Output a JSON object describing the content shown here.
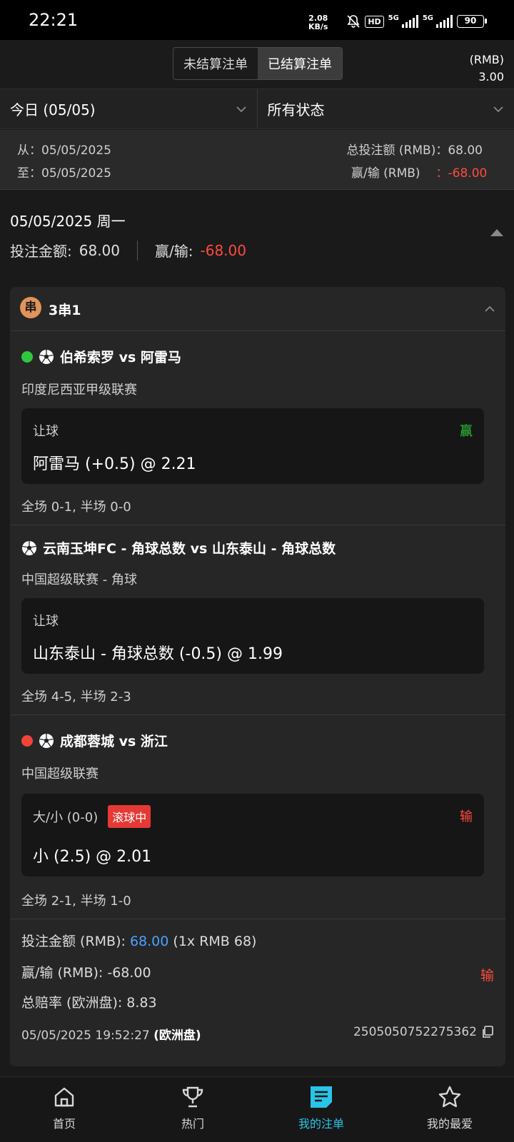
{
  "status_bar": {
    "time": "22:21",
    "speed_value": "2.08",
    "speed_unit": "KB/s",
    "network_1": "5G",
    "network_2": "5G",
    "battery": "90"
  },
  "header": {
    "tabs": [
      {
        "label": "未结算注单",
        "active": false
      },
      {
        "label": "已结算注单",
        "active": true
      }
    ],
    "currency": "(RMB)",
    "balance": "3.00"
  },
  "filters": {
    "date": "今日 (05/05)",
    "status": "所有状态"
  },
  "summary": {
    "from": "从：05/05/2025",
    "to": "至：05/05/2025",
    "total_stake": "总投注额 (RMB)：68.00",
    "winloss_label": "赢/输 (RMB)",
    "winloss_value": "：-68.00"
  },
  "day": {
    "date": "05/05/2025 周一",
    "stake_label": "投注金额:",
    "stake_value": "68.00",
    "winloss_label": "赢/输:",
    "winloss_value": "-68.00"
  },
  "bet": {
    "type_badge": "串",
    "type": "3串1",
    "legs": [
      {
        "status_dot": "green",
        "match": "伯希索罗 vs 阿雷马",
        "league": "印度尼西亚甲级联赛",
        "market": "让球",
        "selection": "阿雷马 (+0.5) @ 2.21",
        "result": "赢",
        "score": "全场 0-1, 半场 0-0"
      },
      {
        "status_dot": "",
        "match": "云南玉坤FC - 角球总数 vs 山东泰山 - 角球总数",
        "league": "中国超级联赛 - 角球",
        "market": "让球",
        "selection": "山东泰山 - 角球总数 (-0.5) @ 1.99",
        "result": "",
        "score": "全场 4-5, 半场 2-3"
      },
      {
        "status_dot": "red",
        "match": "成都蓉城 vs 浙江",
        "league": "中国超级联赛",
        "market": "大/小 (0-0)",
        "live_tag": "滚球中",
        "selection": "小 (2.5) @ 2.01",
        "result": "输",
        "score": "全场 2-1, 半场 1-0"
      }
    ],
    "stake_label": "投注金额 (RMB):",
    "stake_value": "68.00",
    "stake_detail": "(1x RMB 68)",
    "winloss": "赢/输 (RMB): -68.00",
    "winloss_result": "输",
    "odds": "总赔率 (欧洲盘): 8.83",
    "datetime": "05/05/2025 19:52:27",
    "odds_type": "(欧洲盘)",
    "bet_id": "2505050752275362"
  },
  "nav": [
    {
      "label": "首页",
      "icon": "home-icon"
    },
    {
      "label": "热门",
      "icon": "trophy-icon"
    },
    {
      "label": "我的注单",
      "icon": "bet-slip-icon",
      "active": true
    },
    {
      "label": "我的最爱",
      "icon": "star-icon"
    }
  ],
  "colors": {
    "win": "#2fc83d",
    "lose": "#ff4b3e",
    "accent": "#29c4e8",
    "stake_blue": "#49a2ff",
    "badge": "#e0935a"
  }
}
